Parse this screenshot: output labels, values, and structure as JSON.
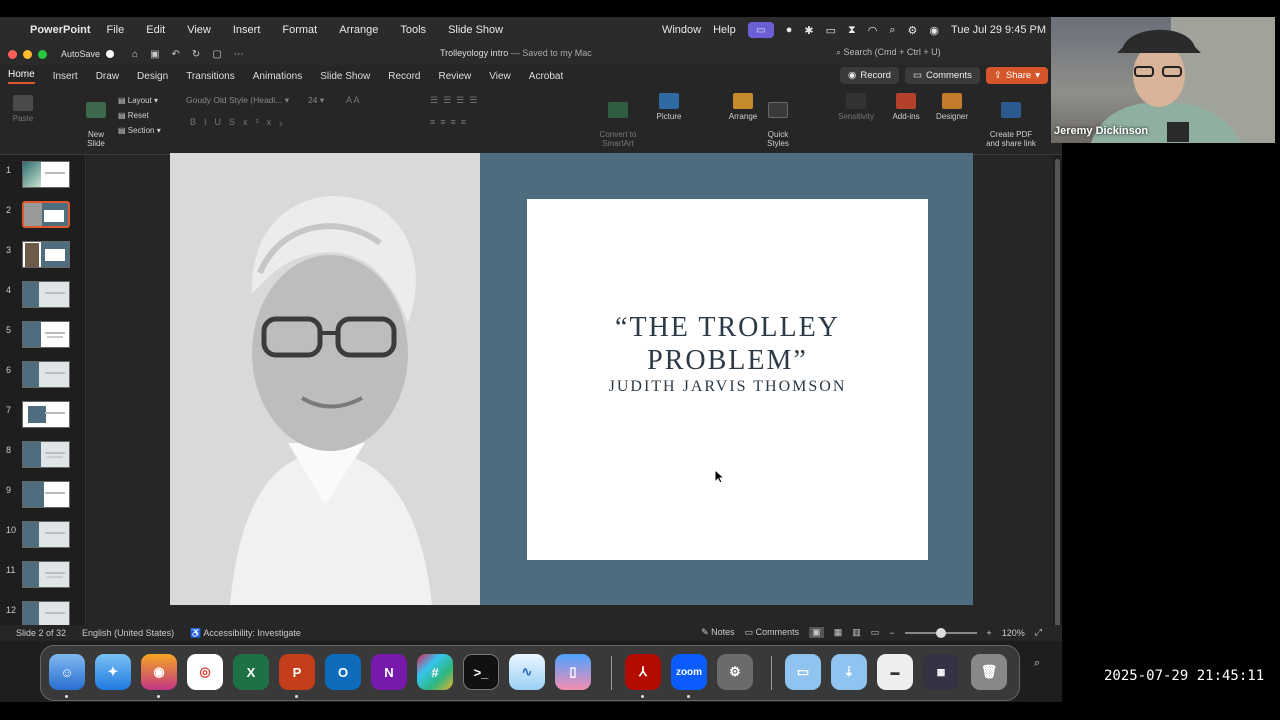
{
  "menubar": {
    "app_name": "PowerPoint",
    "items": [
      "File",
      "Edit",
      "View",
      "Insert",
      "Format",
      "Arrange",
      "Tools",
      "Slide Show"
    ],
    "right_items": [
      "Window",
      "Help"
    ],
    "datetime": "Tue Jul 29  9:45 PM"
  },
  "titlebar": {
    "autosave": "AutoSave",
    "doc_title": "Trolleyology intro",
    "saved_status": " — Saved to my Mac",
    "search_placeholder": "Search (Cmd + Ctrl + U)"
  },
  "ribbon_tabs": [
    "Home",
    "Insert",
    "Draw",
    "Design",
    "Transitions",
    "Animations",
    "Slide Show",
    "Record",
    "Review",
    "View",
    "Acrobat"
  ],
  "ribbon_actions": {
    "record": "Record",
    "comments": "Comments",
    "share": "Share"
  },
  "ribbon": {
    "paste": "Paste",
    "new_slide": "New\nSlide",
    "layout": "Layout",
    "reset": "Reset",
    "section": "Section",
    "font_name": "Goudy Old Style (Headi...",
    "font_size": "24",
    "convert_smartart": "Convert to\nSmartArt",
    "picture": "Picture",
    "arrange": "Arrange",
    "quick_styles": "Quick\nStyles",
    "sensitivity": "Sensitivity",
    "add_ins": "Add-ins",
    "designer": "Designer",
    "create_pdf": "Create PDF\nand share link"
  },
  "thumbnails": [
    "1",
    "2",
    "3",
    "4",
    "5",
    "6",
    "7",
    "8",
    "9",
    "10",
    "11",
    "12"
  ],
  "selected_slide": 2,
  "slide": {
    "title_line1": "“THE TROLLEY",
    "title_line2": "PROBLEM”",
    "subtitle": "JUDITH JARVIS THOMSON"
  },
  "statusbar": {
    "slide_info": "Slide 2 of 32",
    "language": "English (United States)",
    "accessibility": "Accessibility: Investigate",
    "notes": "Notes",
    "comments": "Comments",
    "zoom": "120%",
    "zoom_level": 0.5
  },
  "dock": {
    "zoom_label": "zoom"
  },
  "webcam": {
    "name": "Jeremy Dickinson"
  },
  "timestamp": "2025-07-29 21:45:11",
  "colors": {
    "accent": "#e0562d",
    "slide_bg": "#4d6c7d",
    "title_text": "#2b3a46"
  }
}
